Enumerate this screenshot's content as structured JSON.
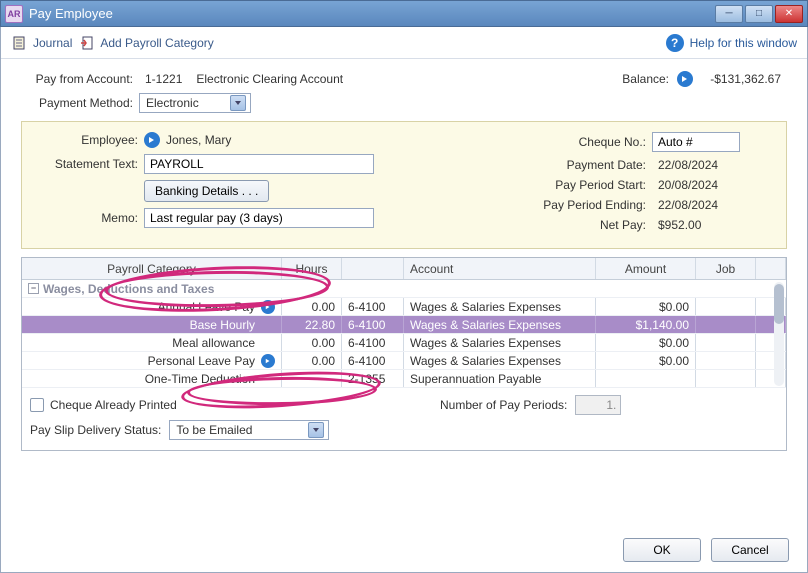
{
  "window": {
    "app_icon": "AR",
    "title": "Pay Employee"
  },
  "toolbar": {
    "journal": "Journal",
    "add_payroll_cat": "Add Payroll Category",
    "help": "Help for this window"
  },
  "header": {
    "pay_from_label": "Pay from Account:",
    "account_code": "1-1221",
    "account_name": "Electronic Clearing Account",
    "payment_method_label": "Payment Method:",
    "payment_method_value": "Electronic",
    "balance_label": "Balance:",
    "balance_value": "-$131,362.67"
  },
  "info": {
    "employee_label": "Employee:",
    "employee_name": "Jones, Mary",
    "statement_label": "Statement Text:",
    "statement_value": "PAYROLL",
    "banking_btn": "Banking Details . . .",
    "memo_label": "Memo:",
    "memo_value": "Last regular pay (3 days)",
    "cheque_no_label": "Cheque No.:",
    "cheque_no_value": "Auto #",
    "payment_date_label": "Payment Date:",
    "payment_date_value": "22/08/2024",
    "period_start_label": "Pay Period Start:",
    "period_start_value": "20/08/2024",
    "period_end_label": "Pay Period Ending:",
    "period_end_value": "22/08/2024",
    "net_pay_label": "Net Pay:",
    "net_pay_value": "$952.00"
  },
  "table": {
    "headers": {
      "category": "Payroll Category",
      "hours": "Hours",
      "account": "Account",
      "amount": "Amount",
      "job": "Job"
    },
    "group": "Wages, Deductions and Taxes",
    "rows": [
      {
        "cat": "Annual Leave Pay",
        "arrow": true,
        "hours": "0.00",
        "code": "6-4100",
        "account": "Wages & Salaries Expenses",
        "amount": "$0.00",
        "selected": false
      },
      {
        "cat": "Base Hourly",
        "arrow": false,
        "hours": "22.80",
        "code": "6-4100",
        "account": "Wages & Salaries Expenses",
        "amount": "$1,140.00",
        "selected": true
      },
      {
        "cat": "Meal allowance",
        "arrow": false,
        "hours": "0.00",
        "code": "6-4100",
        "account": "Wages & Salaries Expenses",
        "amount": "$0.00",
        "selected": false
      },
      {
        "cat": "Personal Leave Pay",
        "arrow": true,
        "hours": "0.00",
        "code": "6-4100",
        "account": "Wages & Salaries Expenses",
        "amount": "$0.00",
        "selected": false
      },
      {
        "cat": "One-Time Deduction",
        "arrow": false,
        "hours": "",
        "code": "2-1355",
        "account": "Superannuation Payable",
        "amount": "",
        "selected": false
      }
    ]
  },
  "bottom": {
    "cheque_printed": "Cheque Already Printed",
    "num_periods_label": "Number of Pay Periods:",
    "num_periods_value": "1.",
    "payslip_label": "Pay Slip Delivery Status:",
    "payslip_value": "To be Emailed"
  },
  "dialog": {
    "ok": "OK",
    "cancel": "Cancel"
  }
}
